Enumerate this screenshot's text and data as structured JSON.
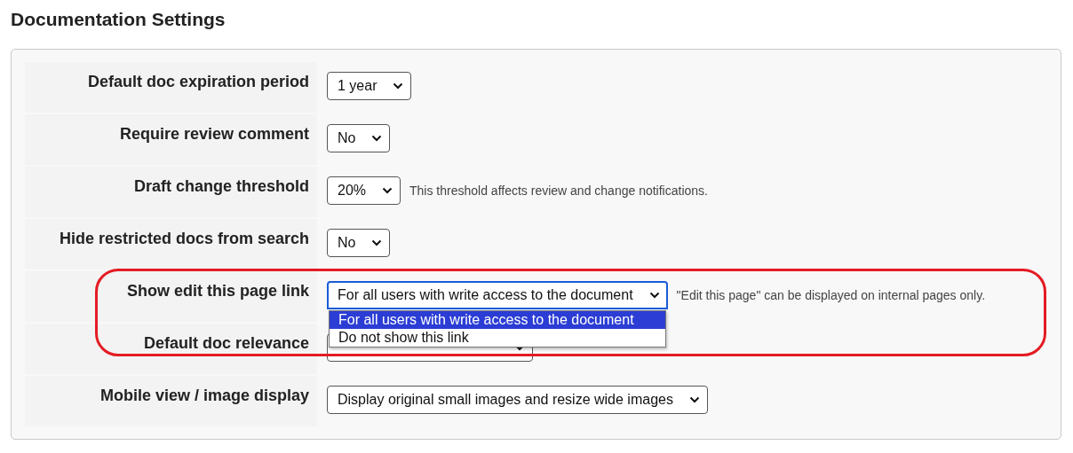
{
  "title": "Documentation Settings",
  "settings": [
    {
      "label": "Default doc expiration period",
      "value": "1 year",
      "focused": false,
      "expanded": false,
      "highlighted": false
    },
    {
      "label": "Require review comment",
      "value": "No",
      "focused": false,
      "expanded": false,
      "highlighted": false
    },
    {
      "label": "Draft change threshold",
      "value": "20%",
      "note": "This threshold affects review and change notifications.",
      "focused": false,
      "expanded": false,
      "highlighted": false
    },
    {
      "label": "Hide restricted docs from search",
      "value": "No",
      "focused": false,
      "expanded": false,
      "highlighted": false
    },
    {
      "label": "Show edit this page link",
      "value": "For all users with write access to the document",
      "note": "\"Edit this page\" can be displayed on internal pages only.",
      "focused": true,
      "expanded": true,
      "highlighted": true,
      "options": [
        {
          "label": "For all users with write access to the document",
          "selected": true
        },
        {
          "label": "Do not show this link",
          "selected": false
        }
      ]
    },
    {
      "label": "Default doc relevance",
      "focused": false,
      "expanded": false,
      "highlighted": false
    },
    {
      "label": "Mobile view / image display",
      "value": "Display original small images and resize wide images",
      "focused": false,
      "expanded": false,
      "highlighted": false
    }
  ]
}
